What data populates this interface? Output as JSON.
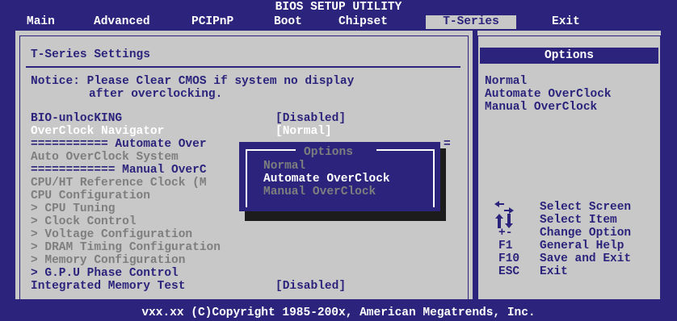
{
  "header": {
    "title": "BIOS SETUP UTILITY",
    "tabs": [
      {
        "label": "Main"
      },
      {
        "label": "Advanced"
      },
      {
        "label": "PCIPnP"
      },
      {
        "label": "Boot"
      },
      {
        "label": "Chipset"
      },
      {
        "label": "T-Series",
        "active": true
      },
      {
        "label": "Exit"
      }
    ]
  },
  "main": {
    "section_title": "T-Series Settings",
    "notice_line1": "Notice: Please Clear CMOS if system no display",
    "notice_line2": "after overclocking.",
    "items": [
      {
        "label": "BIO-unlocKING",
        "value": "[Disabled]"
      },
      {
        "label": "OverClock Navigator",
        "value": "[Normal]"
      },
      {
        "label": "=========== Automate Over",
        "value": "="
      },
      {
        "label": "Auto OverClock System",
        "value": ""
      },
      {
        "label": "============ Manual OverC",
        "value": ""
      },
      {
        "label": "CPU/HT Reference Clock (M",
        "value": ""
      },
      {
        "label": "CPU Configuration",
        "value": ""
      },
      {
        "label": "> CPU Tuning",
        "value": ""
      },
      {
        "label": "> Clock Control",
        "value": ""
      },
      {
        "label": "> Voltage Configuration",
        "value": ""
      },
      {
        "label": "> DRAM Timing Configuration",
        "value": ""
      },
      {
        "label": "> Memory Configuration",
        "value": ""
      },
      {
        "label": "> G.P.U Phase Control",
        "value": ""
      },
      {
        "label": "Integrated Memory Test",
        "value": "[Disabled]"
      }
    ]
  },
  "popup": {
    "title": "Options",
    "options": [
      "Normal",
      "Automate OverClock",
      "Manual OverClock"
    ],
    "selected": "Automate OverClock"
  },
  "side": {
    "header": "Options",
    "options": [
      "Normal",
      "Automate OverClock",
      "Manual OverClock"
    ],
    "help": [
      {
        "key": "",
        "icon": "left-right-arrows-icon",
        "text": "Select Screen"
      },
      {
        "key": "",
        "icon": "up-down-arrows-icon",
        "text": "Select Item"
      },
      {
        "key": "+-",
        "text": "Change Option"
      },
      {
        "key": "F1",
        "text": "General Help"
      },
      {
        "key": "F10",
        "text": "Save and Exit"
      },
      {
        "key": "ESC",
        "text": "Exit"
      }
    ]
  },
  "footer": {
    "text": "vxx.xx (C)Copyright 1985-200x, American Megatrends, Inc."
  },
  "colors": {
    "background": "#2c247c",
    "panel": "#c8c8c8",
    "highlight": "#ffffff",
    "disabled": "#7e7e7e"
  }
}
